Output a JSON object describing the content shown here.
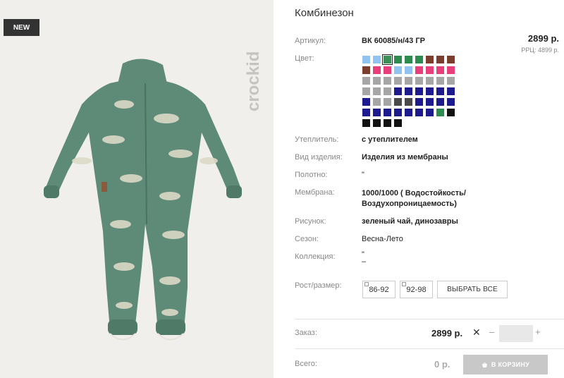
{
  "badge": {
    "new": "NEW"
  },
  "brand": {
    "name": "crockid"
  },
  "product": {
    "title": "Комбинезон",
    "article_label": "Артикул:",
    "article_value": "ВК 60085/н/43 ГР",
    "price": "2899 р.",
    "rrp": "РРЦ: 4899 р.",
    "color_label": "Цвет:",
    "swatch_colors": [
      "#90c3ef",
      "#90c3ef",
      "#3a8f57",
      "#2e8b4f",
      "#2e8b4f",
      "#2e8b4f",
      "#7a3d2e",
      "#7a3d2e",
      "#7a3d2e",
      "#7a3d2e",
      "#e83e7c",
      "#e83e7c",
      "#90c3ef",
      "#90c3ef",
      "#e83e7c",
      "#e83e7c",
      "#e83e7c",
      "#e83e7c",
      "#a6a6a6",
      "#a6a6a6",
      "#a6a6a6",
      "#a6a6a6",
      "#a6a6a6",
      "#a6a6a6",
      "#a6a6a6",
      "#a6a6a6",
      "#a6a6a6",
      "#a6a6a6",
      "#a6a6a6",
      "#a6a6a6",
      "#1c1a8c",
      "#1c1a8c",
      "#1c1a8c",
      "#1c1a8c",
      "#1c1a8c",
      "#1c1a8c",
      "#1c1a8c",
      "#a6a6a6",
      "#a6a6a6",
      "#4a4a4a",
      "#4a4a4a",
      "#1c1a8c",
      "#1c1a8c",
      "#1c1a8c",
      "#1c1a8c",
      "#1c1a8c",
      "#1c1a8c",
      "#1c1a8c",
      "#1c1a8c",
      "#1c1a8c",
      "#1c1a8c",
      "#1c1a8c",
      "#2e8b4f",
      "#111111",
      "#111111",
      "#111111",
      "#111111",
      "#111111"
    ],
    "selected_swatch_index": 2,
    "specs": [
      {
        "label": "Утеплитель:",
        "value": "с утеплителем",
        "bold": true
      },
      {
        "label": "Вид изделия:",
        "value": "Изделия из мембраны",
        "bold": true
      },
      {
        "label": "Полотно:",
        "value": "\"",
        "bold": false
      },
      {
        "label": "Мембрана:",
        "value": "1000/1000 ( Водостойкость/ Воздухопроницаемость)",
        "bold": true
      },
      {
        "label": "Рисунок:",
        "value": "зеленый чай, динозавры",
        "bold": true
      },
      {
        "label": "Сезон:",
        "value": "Весна-Лето",
        "bold": false
      },
      {
        "label": "Коллекция:",
        "value": "\" –",
        "bold": false
      }
    ],
    "size_label": "Рост/размер:",
    "sizes": [
      "86-92",
      "92-98"
    ],
    "select_all_label": "ВЫБРАТЬ ВСЕ",
    "order_label": "Заказ:",
    "order_price": "2899 р.",
    "close_symbol": "✕",
    "minus_symbol": "–",
    "plus_symbol": "+",
    "total_label": "Всего:",
    "total_price": "0 р.",
    "cart_button": "В КОРЗИНУ"
  }
}
